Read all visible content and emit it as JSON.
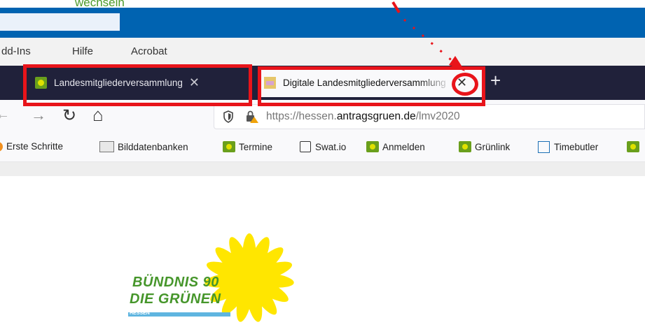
{
  "annotation": {
    "top_text": "wechseln",
    "color": "#e8141a"
  },
  "menubar": {
    "items": [
      "dd-Ins",
      "Hilfe",
      "Acrobat"
    ]
  },
  "tabs": [
    {
      "label": "Landesmitgliederversammlung",
      "close": "✕",
      "active": false
    },
    {
      "label": "Digitale Landesmitgliederversammlung",
      "close": "✕",
      "active": true
    }
  ],
  "newtab": "+",
  "nav": {
    "back": "←",
    "forward": "→",
    "reload": "↻",
    "home": "⌂"
  },
  "url": {
    "prefix": "https://hessen.",
    "domain": "antragsgruen.de",
    "path": "/lmv2020"
  },
  "bookmarks": [
    "Erste Schritte",
    "Bilddatenbanken",
    "Termine",
    "Swat.io",
    "Anmelden",
    "Grünlink",
    "Timebutler"
  ],
  "logo": {
    "line1": "BÜNDNIS 90",
    "line2": "DIE GRÜNEN",
    "ribbon": "HESSEN"
  },
  "colors": {
    "titlebar": "#0063b1",
    "tabbar": "#20213a",
    "brand_green": "#46962b",
    "sunflower": "#ffe600"
  }
}
